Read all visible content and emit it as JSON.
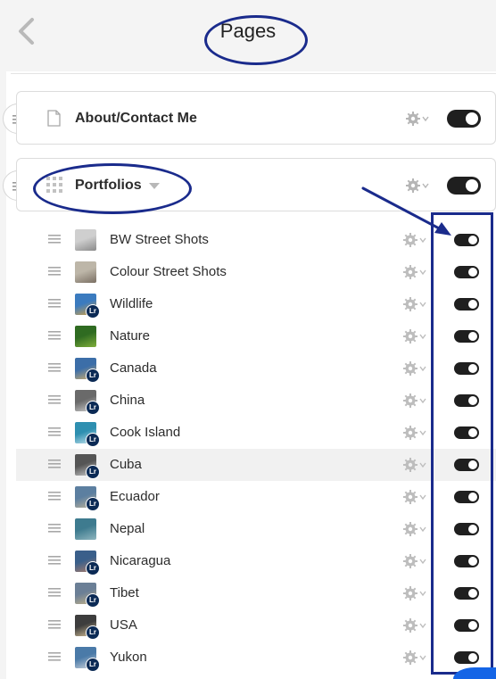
{
  "header": {
    "title": "Pages"
  },
  "top_pages": [
    {
      "label": "About/Contact Me",
      "icon": "document-icon"
    },
    {
      "label": "Portfolios",
      "icon": "grid-icon"
    }
  ],
  "portfolios": [
    {
      "label": "BW Street Shots",
      "lr": false
    },
    {
      "label": "Colour Street Shots",
      "lr": false
    },
    {
      "label": "Wildlife",
      "lr": true
    },
    {
      "label": "Nature",
      "lr": false
    },
    {
      "label": "Canada",
      "lr": true
    },
    {
      "label": "China",
      "lr": true
    },
    {
      "label": "Cook Island",
      "lr": true
    },
    {
      "label": "Cuba",
      "lr": true
    },
    {
      "label": "Ecuador",
      "lr": true
    },
    {
      "label": "Nepal",
      "lr": false
    },
    {
      "label": "Nicaragua",
      "lr": true
    },
    {
      "label": "Tibet",
      "lr": true
    },
    {
      "label": "USA",
      "lr": true
    },
    {
      "label": "Yukon",
      "lr": true
    }
  ],
  "lr_badge": "Lr",
  "colors": {
    "annotation": "#1a2b8c",
    "toggle_on": "#1f1f1f"
  }
}
